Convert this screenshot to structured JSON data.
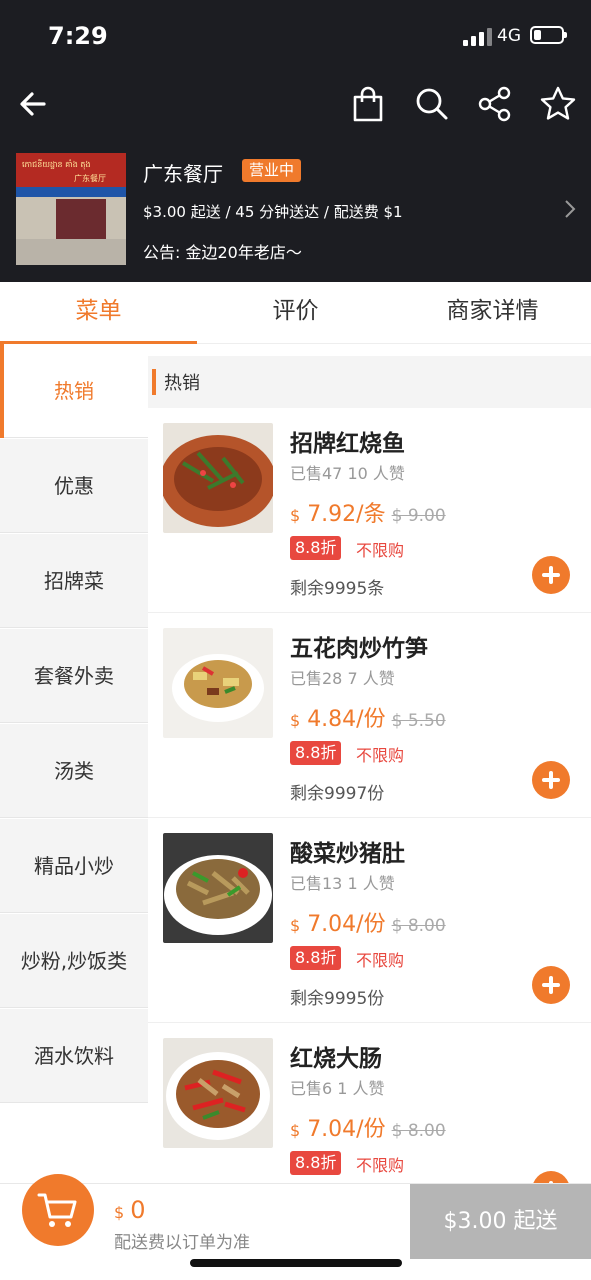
{
  "status_bar": {
    "time": "7:29",
    "network": "4G",
    "battery_percent": 25
  },
  "nav": {
    "back_icon": "back-arrow-icon",
    "icons": [
      "shopping-bag-icon",
      "search-icon",
      "share-icon",
      "star-icon"
    ]
  },
  "shop": {
    "name": "广东餐厅",
    "status": "营业中",
    "info": "$3.00 起送 / 45 分钟送达 / 配送费 $1",
    "notice": "公告: 金边20年老店～",
    "photo_sign_text": "ភោជនីយដ្ឋាន គាំង តុង",
    "photo_sign_cn": "广东餐厅"
  },
  "tabs": [
    {
      "label": "菜单",
      "active": true
    },
    {
      "label": "评价",
      "active": false
    },
    {
      "label": "商家详情",
      "active": false
    }
  ],
  "categories": [
    {
      "label": "热销",
      "active": true
    },
    {
      "label": "优惠"
    },
    {
      "label": "招牌菜"
    },
    {
      "label": "套餐外卖"
    },
    {
      "label": "汤类"
    },
    {
      "label": "精品小炒"
    },
    {
      "label": "炒粉,炒饭类"
    },
    {
      "label": "酒水饮料"
    }
  ],
  "section": {
    "title": "热销"
  },
  "items": [
    {
      "name": "招牌红烧鱼",
      "stats": "已售47   10 人赞",
      "currency": "$",
      "price": "7.92/条",
      "old_price": "$ 9.00",
      "discount": "8.8折",
      "limit": "不限购",
      "stock": "剩余9995条"
    },
    {
      "name": "五花肉炒竹笋",
      "stats": "已售28   7 人赞",
      "currency": "$",
      "price": "4.84/份",
      "old_price": "$ 5.50",
      "discount": "8.8折",
      "limit": "不限购",
      "stock": "剩余9997份"
    },
    {
      "name": "酸菜炒猪肚",
      "stats": "已售13   1 人赞",
      "currency": "$",
      "price": "7.04/份",
      "old_price": "$ 8.00",
      "discount": "8.8折",
      "limit": "不限购",
      "stock": "剩余9995份"
    },
    {
      "name": "红烧大肠",
      "stats": "已售6   1 人赞",
      "currency": "$",
      "price": "7.04/份",
      "old_price": "$ 8.00",
      "discount": "8.8折",
      "limit": "不限购",
      "stock": ""
    }
  ],
  "cart": {
    "currency": "$",
    "total": "0",
    "note": "配送费以订单为准",
    "checkout_label": "$3.00 起送"
  },
  "colors": {
    "accent": "#f07a2c",
    "header_bg": "#1c1d22",
    "discount_red": "#e8483f"
  }
}
